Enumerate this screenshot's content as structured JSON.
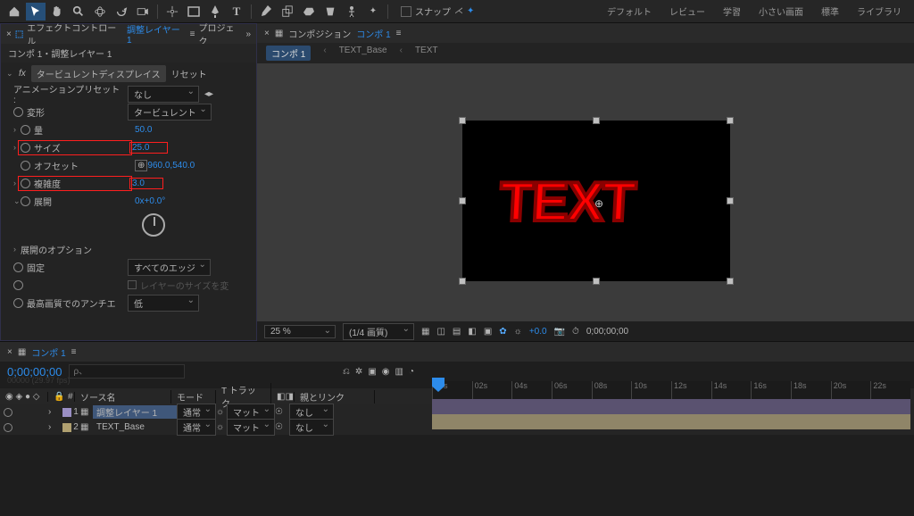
{
  "toolbar": {
    "snap": "スナップ"
  },
  "workspaces": [
    "デフォルト",
    "レビュー",
    "学習",
    "小さい画面",
    "標準",
    "ライブラリ"
  ],
  "effects": {
    "panel_title": "エフェクトコントロール",
    "panel_layer": "調整レイヤー 1",
    "project_tab": "プロジェク",
    "breadcrumb": "コンポ 1・調整レイヤー 1",
    "fx_name": "タービュレントディスプレイス",
    "reset": "リセット",
    "preset_label": "アニメーションプリセット :",
    "preset_value": "なし",
    "deform_label": "変形",
    "deform_value": "タービュレント",
    "amount_label": "量",
    "amount_value": "50.0",
    "size_label": "サイズ",
    "size_value": "25.0",
    "offset_label": "オフセット",
    "offset_value": "960.0,540.0",
    "complexity_label": "複雑度",
    "complexity_value": "3.0",
    "evolution_label": "展開",
    "evolution_value": "0x+0.0°",
    "evo_options": "展開のオプション",
    "pin_label": "固定",
    "pin_value": "すべてのエッジ",
    "resize_label": "レイヤーのサイズを変",
    "aa_label": "最高画質でのアンチエ",
    "aa_value": "低"
  },
  "comp": {
    "panel_title": "コンポジション",
    "panel_name": "コンポ 1",
    "tabs": [
      "コンポ 1",
      "TEXT_Base",
      "TEXT"
    ],
    "canvas_text": "TEXT",
    "zoom": "25 %",
    "res": "(1/4 画質)",
    "exposure": "+0.0",
    "timecode": "0;00;00;00"
  },
  "timeline": {
    "tab": "コンポ 1",
    "time": "0;00;00;00",
    "fps": "00000 (29.97 fps)",
    "search_ph": "ρ、",
    "cols": {
      "num": "#",
      "source": "ソース名",
      "mode": "モード",
      "trk": "T トラック...",
      "parent": "親とリンク"
    },
    "layers": [
      {
        "num": "1",
        "name": "調整レイヤー 1",
        "mode": "通常",
        "link": "なし"
      },
      {
        "num": "2",
        "name": "TEXT_Base",
        "mode": "通常",
        "link": "なし"
      }
    ],
    "ticks": [
      "00s",
      "02s",
      "04s",
      "06s",
      "08s",
      "10s",
      "12s",
      "14s",
      "16s",
      "18s",
      "20s",
      "22s"
    ],
    "matte": "マット"
  }
}
